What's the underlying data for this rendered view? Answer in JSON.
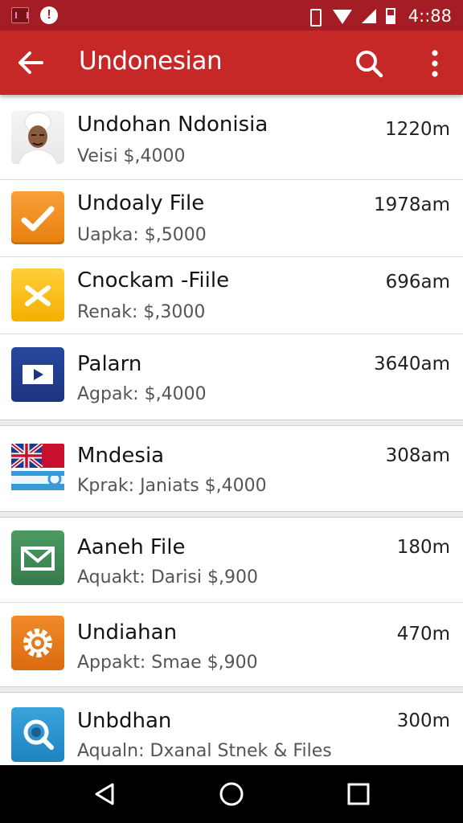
{
  "status_bar": {
    "time": "4::88",
    "icons": [
      "app-notification-icon",
      "alert-icon",
      "vibrate-icon",
      "wifi-icon",
      "signal-icon",
      "battery-icon"
    ]
  },
  "app_bar": {
    "title": "Undonesian",
    "back_icon": "arrow-back-icon",
    "search_icon": "search-icon",
    "more_icon": "more-vert-icon",
    "color": "#c62828"
  },
  "list": {
    "items": [
      {
        "title": "Undohan Ndonisia",
        "subtitle": "Veisi $,4000",
        "time": "1220m",
        "icon": "person-avatar-icon"
      },
      {
        "title": "Undoaly File",
        "subtitle": "Uapka: $,5000",
        "time": "1978am",
        "icon": "orange-check-icon"
      },
      {
        "title": "Cnockam -Fiile",
        "subtitle": "Renak: $,3000",
        "time": "696am",
        "icon": "yellow-cross-icon"
      },
      {
        "title": "Palarn",
        "subtitle": "Agpak: $,4000",
        "time": "3640am",
        "icon": "navy-play-icon"
      },
      {
        "title": "Mndesia",
        "subtitle": "Kprak: Janiats $,4000",
        "time": "308am",
        "icon": "flag-icon"
      },
      {
        "title": "Aaneh File",
        "subtitle": "Aquakt: Darisi $,900",
        "time": "180m",
        "icon": "green-mail-icon"
      },
      {
        "title": "Undiahan",
        "subtitle": "Appakt: Smae $,900",
        "time": "470m",
        "icon": "orange-gear-icon"
      },
      {
        "title": "Unbdhan",
        "subtitle": "Aqualn: Dxanal Stnek & Files",
        "time": "300m",
        "icon": "blue-search-icon"
      }
    ]
  },
  "nav_bar": {
    "icons": [
      "nav-back-icon",
      "nav-home-icon",
      "nav-recents-icon"
    ]
  }
}
